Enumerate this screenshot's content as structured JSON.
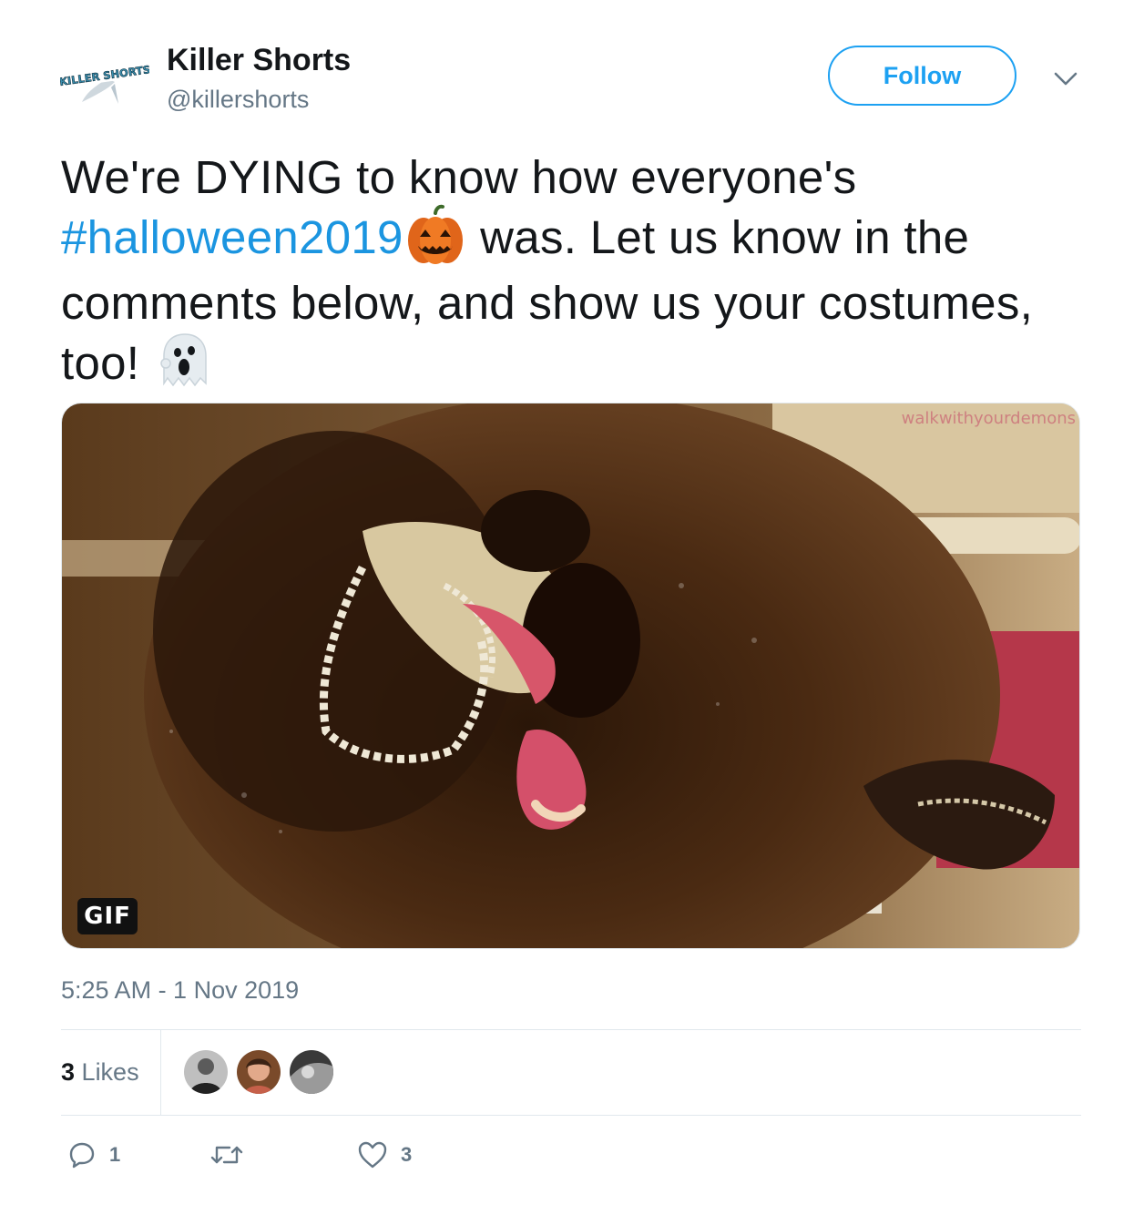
{
  "author": {
    "display_name": "Killer Shorts",
    "handle": "@killershorts",
    "avatar_logo_text": "KILLER SHORTS"
  },
  "header": {
    "follow_label": "Follow",
    "caret_icon": "chevron-down-icon"
  },
  "tweet": {
    "text_part1": "We're DYING to know how everyone's",
    "hashtag": "#halloween2019",
    "emoji_1": "jack-o-lantern",
    "text_part2": " was. Let us know in the comments below, and show us your costumes, too! ",
    "emoji_2": "ghost"
  },
  "media": {
    "badge": "GIF",
    "watermark": "walkwithyourdemons"
  },
  "meta": {
    "timestamp": "5:25 AM - 1 Nov 2019"
  },
  "likes": {
    "count": "3",
    "label": "Likes"
  },
  "actions": {
    "reply_count": "1",
    "retweet_count": "",
    "like_count": "3"
  },
  "colors": {
    "accent": "#1da1f2",
    "hashtag": "#1b95e0",
    "muted": "#657786",
    "border": "#e1e8ed"
  }
}
